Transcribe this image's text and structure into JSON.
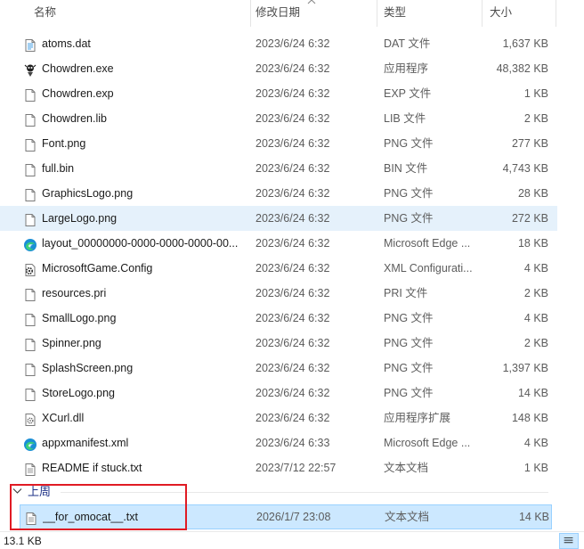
{
  "columns": {
    "name": "名称",
    "date": "修改日期",
    "type": "类型",
    "size": "大小"
  },
  "files": [
    {
      "name": "atoms.dat",
      "date": "2023/6/24 6:32",
      "type": "DAT 文件",
      "size": "1,637 KB",
      "icon": "document-icon"
    },
    {
      "name": "Chowdren.exe",
      "date": "2023/6/24 6:32",
      "type": "应用程序",
      "size": "48,382 KB",
      "icon": "app-character-icon"
    },
    {
      "name": "Chowdren.exp",
      "date": "2023/6/24 6:32",
      "type": "EXP 文件",
      "size": "1 KB",
      "icon": "file-icon"
    },
    {
      "name": "Chowdren.lib",
      "date": "2023/6/24 6:32",
      "type": "LIB 文件",
      "size": "2 KB",
      "icon": "file-icon"
    },
    {
      "name": "Font.png",
      "date": "2023/6/24 6:32",
      "type": "PNG 文件",
      "size": "277 KB",
      "icon": "file-icon"
    },
    {
      "name": "full.bin",
      "date": "2023/6/24 6:32",
      "type": "BIN 文件",
      "size": "4,743 KB",
      "icon": "file-icon"
    },
    {
      "name": "GraphicsLogo.png",
      "date": "2023/6/24 6:32",
      "type": "PNG 文件",
      "size": "28 KB",
      "icon": "file-icon"
    },
    {
      "name": "LargeLogo.png",
      "date": "2023/6/24 6:32",
      "type": "PNG 文件",
      "size": "272 KB",
      "icon": "file-icon",
      "hover": true
    },
    {
      "name": "layout_00000000-0000-0000-0000-00...",
      "date": "2023/6/24 6:32",
      "type": "Microsoft Edge ...",
      "size": "18 KB",
      "icon": "edge-icon"
    },
    {
      "name": "MicrosoftGame.Config",
      "date": "2023/6/24 6:32",
      "type": "XML Configurati...",
      "size": "4 KB",
      "icon": "config-gear-icon"
    },
    {
      "name": "resources.pri",
      "date": "2023/6/24 6:32",
      "type": "PRI 文件",
      "size": "2 KB",
      "icon": "file-icon"
    },
    {
      "name": "SmallLogo.png",
      "date": "2023/6/24 6:32",
      "type": "PNG 文件",
      "size": "4 KB",
      "icon": "file-icon"
    },
    {
      "name": "Spinner.png",
      "date": "2023/6/24 6:32",
      "type": "PNG 文件",
      "size": "2 KB",
      "icon": "file-icon"
    },
    {
      "name": "SplashScreen.png",
      "date": "2023/6/24 6:32",
      "type": "PNG 文件",
      "size": "1,397 KB",
      "icon": "file-icon"
    },
    {
      "name": "StoreLogo.png",
      "date": "2023/6/24 6:32",
      "type": "PNG 文件",
      "size": "14 KB",
      "icon": "file-icon"
    },
    {
      "name": "XCurl.dll",
      "date": "2023/6/24 6:32",
      "type": "应用程序扩展",
      "size": "148 KB",
      "icon": "dll-icon"
    },
    {
      "name": "appxmanifest.xml",
      "date": "2023/6/24 6:33",
      "type": "Microsoft Edge ...",
      "size": "4 KB",
      "icon": "edge-icon"
    },
    {
      "name": "README if stuck.txt",
      "date": "2023/7/12 22:57",
      "type": "文本文档",
      "size": "1 KB",
      "icon": "text-file-icon"
    }
  ],
  "group": {
    "label": "上周"
  },
  "group_files": [
    {
      "name": "__for_omocat__.txt",
      "date": "2026/1/7 23:08",
      "type": "文本文档",
      "size": "14 KB",
      "icon": "text-file-icon",
      "selected": true
    }
  ],
  "status": {
    "selection_size": "13.1 KB"
  },
  "colors": {
    "selection_bg": "#cce8ff",
    "selection_border": "#99d1ff",
    "hover_bg": "#e5f1fb",
    "group_label": "#1e3287",
    "annotation_red": "#e01b24"
  }
}
